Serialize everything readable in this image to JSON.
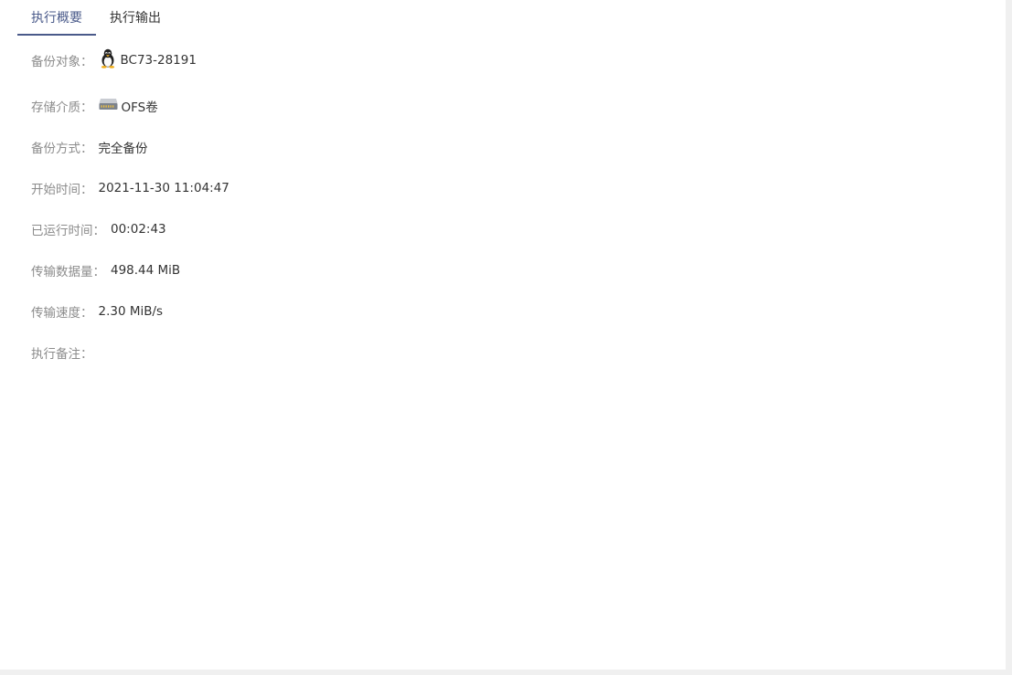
{
  "tabs": [
    {
      "label": "执行概要",
      "active": true
    },
    {
      "label": "执行输出",
      "active": false
    }
  ],
  "fields": {
    "backup_target": {
      "label": "备份对象：",
      "value": "BC73-28191",
      "icon": "linux-penguin-icon"
    },
    "storage_medium": {
      "label": "存储介质：",
      "value": "OFS卷",
      "icon": "storage-drive-icon"
    },
    "backup_method": {
      "label": "备份方式：",
      "value": "完全备份"
    },
    "start_time": {
      "label": "开始时间：",
      "value": "2021-11-30 11:04:47"
    },
    "elapsed_time": {
      "label": "已运行时间：",
      "value": "00:02:43"
    },
    "transferred_data": {
      "label": "传输数据量：",
      "value": "498.44 MiB"
    },
    "transfer_speed": {
      "label": "传输速度：",
      "value": "2.30 MiB/s"
    },
    "execution_note": {
      "label": "执行备注：",
      "value": ""
    }
  },
  "colors": {
    "active_tab": "#4a5a8a",
    "label": "#8c8c8c",
    "value": "#333333"
  }
}
